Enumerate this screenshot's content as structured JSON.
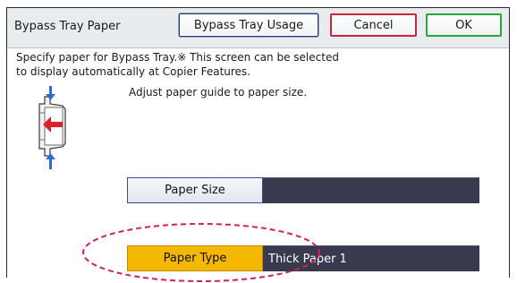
{
  "title": "Bypass Tray Paper",
  "buttons": {
    "usage": "Bypass Tray Usage",
    "cancel": "Cancel",
    "ok": "OK"
  },
  "description": {
    "line1": "Specify paper for Bypass Tray.※ This screen can be selected",
    "line2": "to display automatically at Copier Features."
  },
  "instruction": "Adjust paper guide to paper size.",
  "paper_size": {
    "label": "Paper Size",
    "value": ""
  },
  "paper_type": {
    "label": "Paper Type",
    "value": "Thick Paper 1"
  },
  "colors": {
    "accent_selected": "#f5b800",
    "cancel_border": "#c8263d",
    "ok_border": "#27a83a",
    "value_bg": "#3a3a4e",
    "highlight_oval": "#d0215a"
  },
  "icons": [
    "bypass-tray-icon",
    "arrow-down-icon",
    "arrow-left-icon",
    "arrow-up-icon"
  ]
}
